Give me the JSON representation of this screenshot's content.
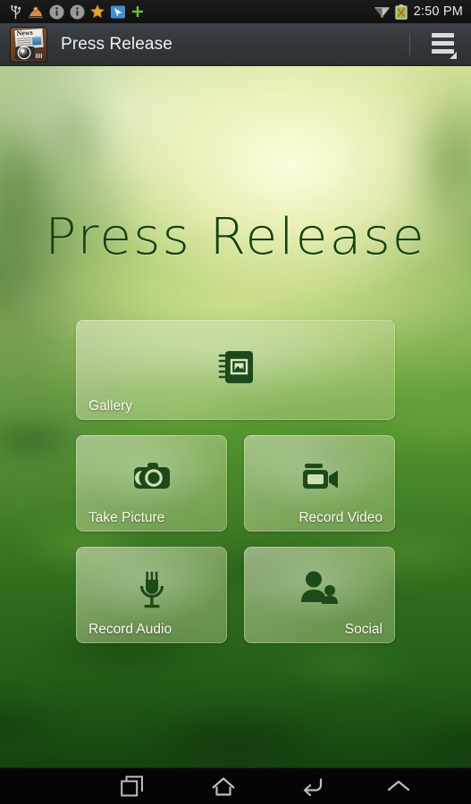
{
  "status_bar": {
    "icons": [
      {
        "name": "usb-icon",
        "label": "USB"
      },
      {
        "name": "adb-debug-icon",
        "label": "ADB debugging"
      },
      {
        "name": "info-icon-1",
        "label": "Info"
      },
      {
        "name": "info-icon-2",
        "label": "Info"
      },
      {
        "name": "star-icon",
        "label": "Star"
      },
      {
        "name": "pointer-icon",
        "label": "Pointer"
      },
      {
        "name": "plus-icon",
        "label": "Add"
      }
    ],
    "wifi_icon": "wifi-icon",
    "battery_icon": "battery-icon",
    "clock": "2:50 PM"
  },
  "action_bar": {
    "app_icon": "press-release-app-icon",
    "app_icon_text": "News",
    "title": "Press Release",
    "overflow_menu": "overflow-menu-icon"
  },
  "hero": {
    "title": "Press Release"
  },
  "tiles": [
    {
      "id": "gallery",
      "label": "Gallery",
      "icon": "photo-album-icon",
      "align": "left",
      "span": "full"
    },
    {
      "id": "take-picture",
      "label": "Take Picture",
      "icon": "camera-icon",
      "align": "left",
      "span": "half"
    },
    {
      "id": "record-video",
      "label": "Record Video",
      "icon": "video-camera-icon",
      "align": "right",
      "span": "half"
    },
    {
      "id": "record-audio",
      "label": "Record Audio",
      "icon": "microphone-icon",
      "align": "left",
      "span": "half"
    },
    {
      "id": "social",
      "label": "Social",
      "icon": "people-icon",
      "align": "right",
      "span": "half"
    }
  ],
  "nav_bar": {
    "buttons": [
      {
        "name": "recents-button",
        "icon": "recents-icon",
        "label": "Recent apps"
      },
      {
        "name": "home-button",
        "icon": "home-icon",
        "label": "Home"
      },
      {
        "name": "back-button",
        "icon": "back-icon",
        "label": "Back"
      },
      {
        "name": "expand-button",
        "icon": "chevron-up-icon",
        "label": "Expand"
      }
    ]
  },
  "colors": {
    "icon_green": "#1d4a1b",
    "title_green": "#12430f",
    "action_bar": "#33383c",
    "tile_tint": "#cfdfa6",
    "label_white": "#fbfbf6"
  }
}
